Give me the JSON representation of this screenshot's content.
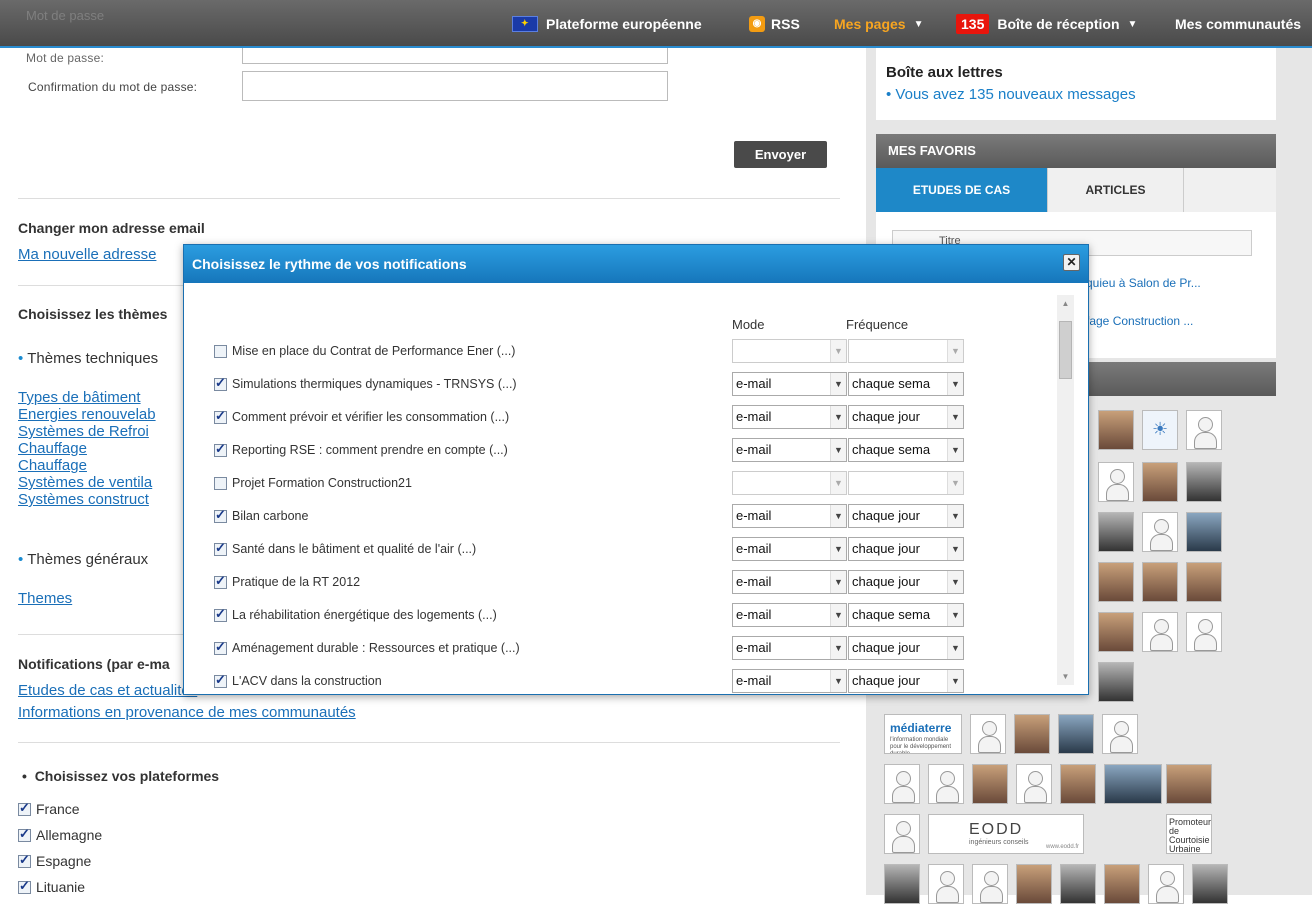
{
  "topbar": {
    "ghost_label": "Mot de passe",
    "platform": "Plateforme européenne",
    "rss": "RSS",
    "mes_pages": "Mes pages",
    "inbox_count": "135",
    "inbox": "Boîte de réception",
    "communities": "Mes communautés"
  },
  "form": {
    "password_label": "Mot de passe:",
    "confirm_label": "Confirmation du mot de passe:",
    "password_value": "",
    "confirm_value": "",
    "submit": "Envoyer",
    "email_section": "Changer mon adresse email",
    "new_email_link": "Ma nouvelle adresse",
    "themes_section": "Choisissez les thèmes",
    "themes_technical": "Thèmes techniques",
    "technical_links": [
      "Types de bâtiment",
      "Energies renouvelab",
      "Systèmes de Refroi",
      "Chauffage",
      "Chauffage",
      "Systèmes de ventila",
      "Systèmes construct"
    ],
    "themes_general": "Thèmes généraux",
    "general_link": "Themes",
    "notif_section": "Notifications (par e-ma",
    "notif_links": [
      "Etudes de cas et actualités",
      "Informations en provenance de mes communautés"
    ],
    "platforms_section": "Choisissez vos plateformes",
    "platforms": [
      {
        "name": "France",
        "checked": true
      },
      {
        "name": "Allemagne",
        "checked": true
      },
      {
        "name": "Espagne",
        "checked": true
      },
      {
        "name": "Lituanie",
        "checked": true
      }
    ]
  },
  "sidebar": {
    "mailbox_title": "Boîte aux lettres",
    "mailbox_msg": "Vous avez 135 nouveaux messages",
    "favorites_head": "MES FAVORIS",
    "tab_cases": "ETUDES DE CAS",
    "tab_articles": "ARTICLES",
    "table_col": "Titre",
    "fav_items": [
      "quieu à Salon de Pr...",
      "fage Construction ..."
    ],
    "logo_mediaterre": "médiaterre",
    "logo_mediaterre_sub": "l'information mondiale pour le développement durable",
    "logo_eodd": "EODD",
    "logo_eodd_sub": "ingénieurs conseils",
    "logo_eodd_url": "www.eodd.fr",
    "logo_promoteur": "Promoteur de Courtoisie Urbaine"
  },
  "modal": {
    "title": "Choisissez le rythme de vos notifications",
    "close": "✕",
    "col_mode": "Mode",
    "col_freq": "Fréquence",
    "rows": [
      {
        "label": "Mise en place du Contrat de Performance Ener (...)",
        "checked": false,
        "mode": "",
        "freq": ""
      },
      {
        "label": "Simulations thermiques dynamiques - TRNSYS (...)",
        "checked": true,
        "mode": "e-mail",
        "freq": "chaque sema"
      },
      {
        "label": "Comment prévoir et vérifier les consommation (...)",
        "checked": true,
        "mode": "e-mail",
        "freq": "chaque jour"
      },
      {
        "label": "Reporting RSE : comment prendre en compte (...)",
        "checked": true,
        "mode": "e-mail",
        "freq": "chaque sema"
      },
      {
        "label": "Projet Formation Construction21",
        "checked": false,
        "mode": "",
        "freq": ""
      },
      {
        "label": "Bilan carbone",
        "checked": true,
        "mode": "e-mail",
        "freq": "chaque jour"
      },
      {
        "label": "Santé dans le bâtiment et qualité de l'air (...)",
        "checked": true,
        "mode": "e-mail",
        "freq": "chaque jour"
      },
      {
        "label": "Pratique de la RT 2012",
        "checked": true,
        "mode": "e-mail",
        "freq": "chaque jour"
      },
      {
        "label": "La réhabilitation énergétique des logements (...)",
        "checked": true,
        "mode": "e-mail",
        "freq": "chaque sema"
      },
      {
        "label": "Aménagement durable : Ressources et pratique (...)",
        "checked": true,
        "mode": "e-mail",
        "freq": "chaque jour"
      },
      {
        "label": "L'ACV dans la construction",
        "checked": true,
        "mode": "e-mail",
        "freq": "chaque jour"
      }
    ]
  }
}
